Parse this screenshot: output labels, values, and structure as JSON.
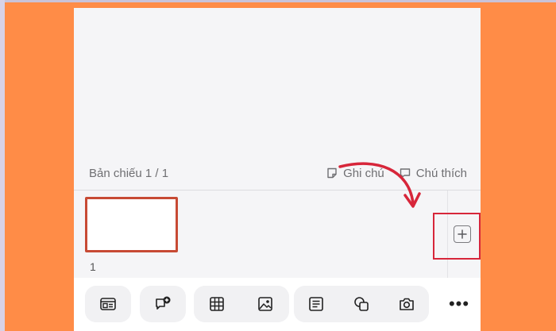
{
  "footer_bar": {
    "slide_counter": "Bản chiếu 1 / 1",
    "notes_label": "Ghi chú",
    "comments_label": "Chú thích"
  },
  "slide_strip": {
    "slides": [
      {
        "number": "1"
      }
    ],
    "add_slide_icon": "plus-square-icon"
  },
  "toolbar": {
    "items": [
      {
        "icon": "layout-icon"
      },
      {
        "icon": "comment-add-icon"
      },
      {
        "icon": "table-icon"
      },
      {
        "icon": "image-icon"
      },
      {
        "icon": "text-box-icon"
      },
      {
        "icon": "shapes-icon"
      },
      {
        "icon": "camera-icon"
      },
      {
        "icon": "more-icon"
      }
    ],
    "more_label": "•••"
  },
  "colors": {
    "frame_bg": "#ff8c47",
    "annotation_red": "#d7263a",
    "thumb_border": "#c74a34"
  }
}
